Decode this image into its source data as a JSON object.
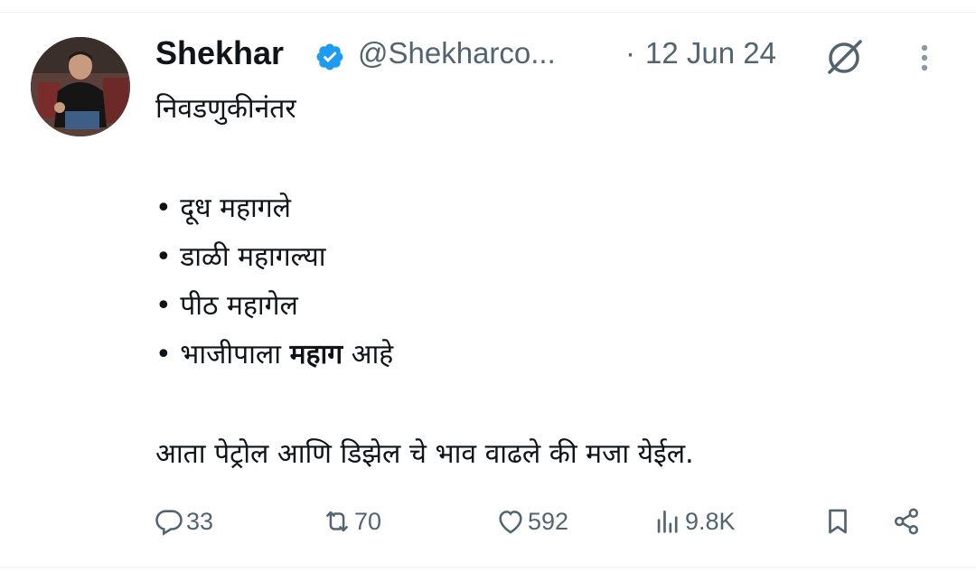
{
  "author": {
    "name": "Shekhar",
    "handle": "@Shekharco...",
    "date": "12 Jun 24",
    "separator": "·"
  },
  "tweet": {
    "line1": "निवडणुकीनंतर",
    "bullets": [
      "• दूध महागले",
      "• डाळी महागल्या",
      "• पीठ महागेल"
    ],
    "bullet4_prefix": "• भाजीपाला ",
    "bullet4_bold": "महाग",
    "bullet4_suffix": " आहे",
    "closing": "आता पेट्रोल आणि डिझेल चे भाव वाढले की मजा येईल."
  },
  "actions": {
    "replies": "33",
    "reposts": "70",
    "likes": "592",
    "views": "9.8K"
  },
  "colors": {
    "verified": "#1d9bf0",
    "muted": "#536471",
    "text": "#0f1419"
  }
}
